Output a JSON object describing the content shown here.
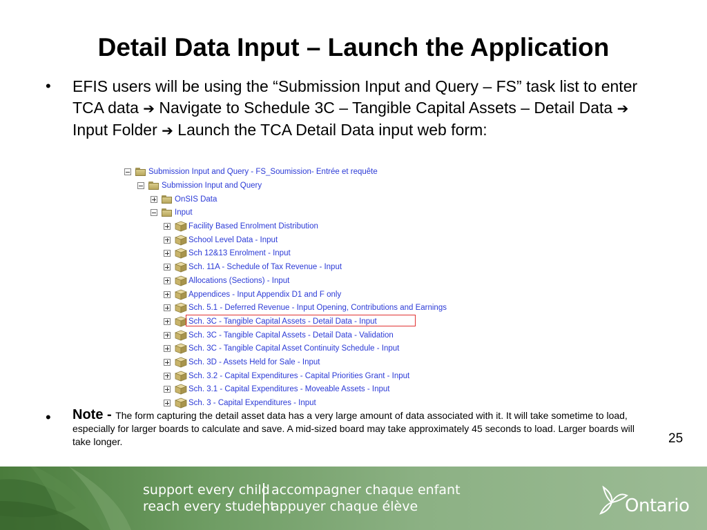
{
  "slide": {
    "title": "Detail Data Input – Launch the Application",
    "page_number": "25"
  },
  "intro": {
    "bullet": "•",
    "part1": "EFIS users will be using the “Submission Input and Query – FS” task list to enter TCA data ",
    "part2": " Navigate to Schedule 3C – Tangible Capital Assets – Detail Data ",
    "part3": " Input Folder ",
    "part4": " Launch the TCA Detail Data input web form:",
    "arrow": "➔"
  },
  "tree": {
    "root": "Submission Input and Query - FS_Soumission- Entrée et requête",
    "child": "Submission Input and Query",
    "folders": [
      "OnSIS Data",
      "Input"
    ],
    "items": [
      "Facility Based Enrolment Distribution",
      "School Level Data - Input",
      "Sch 12&13 Enrolment - Input",
      "Sch. 11A - Schedule of Tax Revenue - Input",
      "Allocations (Sections) - Input",
      "Appendices - Input Appendix D1 and F only",
      "Sch. 5.1 - Deferred Revenue - Input Opening, Contributions and Earnings",
      "Sch. 3C - Tangible Capital Assets - Detail Data - Input",
      "Sch. 3C - Tangible Capital Assets - Detail Data - Validation",
      "Sch. 3C - Tangible Capital Asset Continuity Schedule - Input",
      "Sch. 3D - Assets Held for Sale - Input",
      "Sch. 3.2 - Capital Expenditures - Capital Priorities Grant - Input",
      "Sch. 3.1 - Capital Expenditures - Moveable Assets - Input",
      "Sch. 3 - Capital Expenditures - Input"
    ],
    "highlight_color": "#e03030"
  },
  "note": {
    "bullet": "•",
    "label": "Note - ",
    "text": "The form capturing the detail asset data has a very large amount of data associated with it.  It will take sometime to load, especially for larger boards to calculate and save. A mid-sized board may take approximately 45 seconds to load.  Larger boards will take longer."
  },
  "footer": {
    "line1_en": "support every child",
    "line2_en": "reach every student",
    "line1_fr": "accompagner chaque enfant",
    "line2_fr": "appuyer chaque élève",
    "brand": "Ontario"
  },
  "colors": {
    "link_blue": "#2b3ad6",
    "footer_green": "#4a7c3c"
  }
}
